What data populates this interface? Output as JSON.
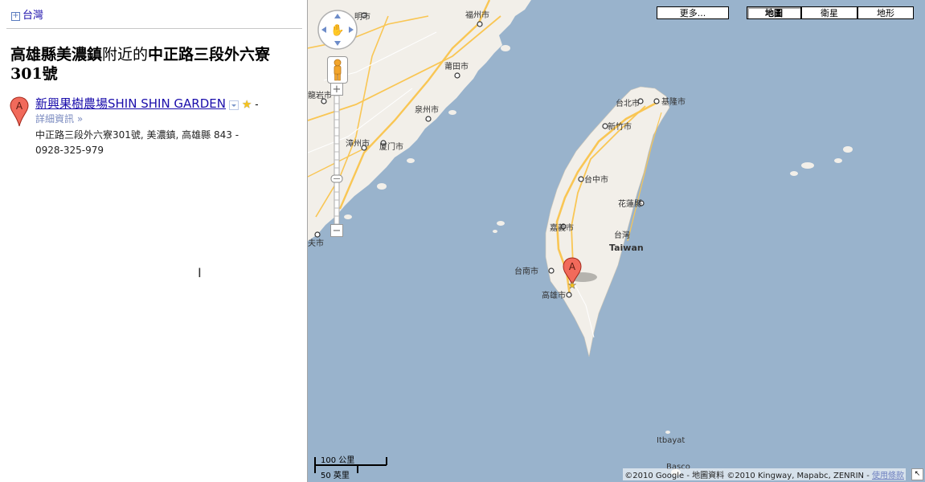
{
  "left_panel": {
    "breadcrumb": "台灣",
    "query_title_part1": "高雄縣美濃鎮",
    "query_title_near": "附近的",
    "query_title_part2": "中正路三段外六寮301號",
    "result": {
      "marker_letter": "A",
      "name": "新興果樹農場SHIN SHIN GARDEN",
      "details_link": "詳細資訊 »",
      "address_line1": "中正路三段外六寮301號, 美濃鎮, 高雄縣 843 -",
      "phone": "0928-325-979"
    }
  },
  "map": {
    "buttons": {
      "more": "更多...",
      "map": "地圖",
      "satellite": "衛星",
      "terrain": "地形"
    },
    "cities": {
      "minghe": "明市",
      "fuzhou": "福州市",
      "putian": "莆田市",
      "quanzhou": "泉州市",
      "longyan": "龍岩市",
      "zhangzhou": "漳州市",
      "xiamen": "厦门市",
      "fushi": "夫市",
      "taipei": "台北市",
      "keelung": "基隆市",
      "hsinchu": "新竹市",
      "taichung": "台中市",
      "hualien": "花蓮縣",
      "chiayi": "嘉義市",
      "taiwan_cn": "台灣",
      "taiwan_en": "Taiwan",
      "tainan": "台南市",
      "kaohsiung": "高雄市",
      "itbayat": "Itbayat",
      "basco": "Basco"
    },
    "marker_letter": "A",
    "scale": {
      "km": "100 公里",
      "mi": "50 英里"
    },
    "copyright": "©2010 Google - 地圖資料 ©2010 Kingway, Mapabc, ZENRIN -",
    "terms": "使用條款",
    "colors": {
      "water": "#99b3cc",
      "land": "#f2efe9",
      "highway": "#f9c654",
      "marker": "#e74c3c"
    }
  }
}
